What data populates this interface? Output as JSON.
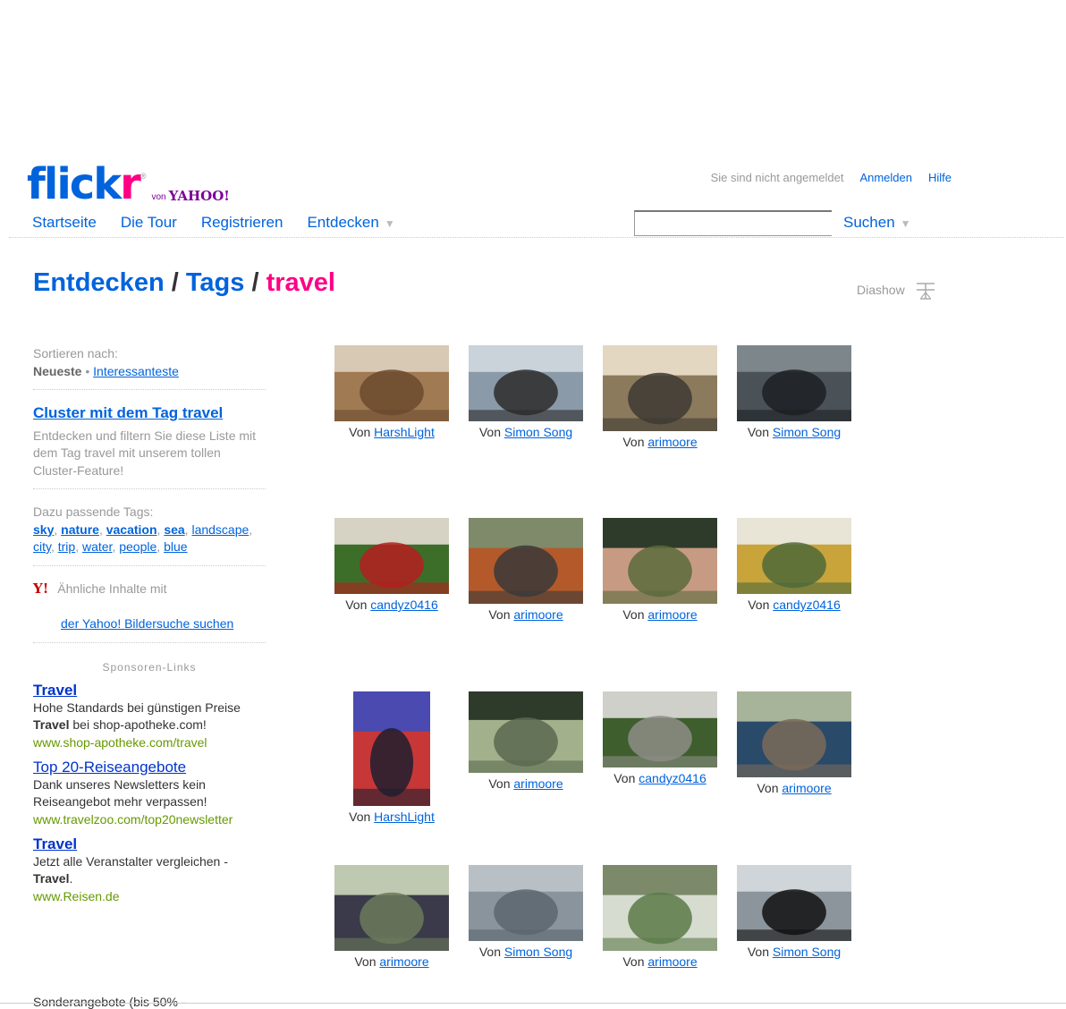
{
  "header": {
    "logo_text": "flickr",
    "logo_von": "von",
    "logo_yahoo": "YAHOO!",
    "status": "Sie sind nicht angemeldet",
    "login": "Anmelden",
    "help": "Hilfe",
    "nav": [
      "Startseite",
      "Die Tour",
      "Registrieren",
      "Entdecken"
    ],
    "search_value": "",
    "search_button": "Suchen"
  },
  "title": {
    "part1": "Entdecken",
    "sep1": "/",
    "part2": "Tags",
    "sep2": "/",
    "tag": "travel"
  },
  "slideshow": "Diashow",
  "sidebar": {
    "sort_label": "Sortieren nach:",
    "sort_current": "Neueste",
    "sort_alt": "Interessanteste",
    "cluster_link": "Cluster mit dem Tag travel",
    "cluster_desc": "Entdecken und filtern Sie diese Liste mit dem Tag travel mit unserem tollen Cluster-Feature!",
    "related_label": "Dazu passende Tags:",
    "related_tags": [
      "sky",
      "nature",
      "vacation",
      "sea",
      "landscape",
      "city",
      "trip",
      "water",
      "people",
      "blue"
    ],
    "yahoo_text": "Ähnliche Inhalte mit",
    "yahoo_link": "der Yahoo! Bildersuche suchen",
    "sponsor_label": "Sponsoren-Links",
    "ads": [
      {
        "title": "Travel",
        "line1": "Hohe Standards bei günstigen Preise ",
        "bold": "Travel",
        "line2": " bei shop-apotheke.com!",
        "url": "www.shop-apotheke.com/travel"
      },
      {
        "title": "Top 20-Reiseangebote",
        "line1": "Dank unseres Newsletters kein Reiseangebot mehr verpassen!",
        "bold": "",
        "line2": "",
        "url": "www.travelzoo.com/top20newsletter"
      },
      {
        "title": "Travel",
        "line1": "Jetzt alle Veranstalter vergleichen - ",
        "bold": "Travel",
        "line2": ".",
        "url": "www.Reisen.de"
      }
    ],
    "cutoff": "Sonderangebote (bis 50% -"
  },
  "photos": [
    {
      "by": "Von",
      "user": "HarshLight",
      "tone": "wood"
    },
    {
      "by": "Von",
      "user": "Simon Song",
      "tone": "balcony"
    },
    {
      "by": "Von",
      "user": "arimoore",
      "tone": "bread"
    },
    {
      "by": "Von",
      "user": "Simon Song",
      "tone": "dusk"
    },
    {
      "by": "Von",
      "user": "candyz0416",
      "tone": "flowers"
    },
    {
      "by": "Von",
      "user": "arimoore",
      "tone": "hug"
    },
    {
      "by": "Von",
      "user": "arimoore",
      "tone": "women"
    },
    {
      "by": "Von",
      "user": "candyz0416",
      "tone": "sign"
    },
    {
      "by": "Von",
      "user": "HarshLight",
      "tone": "figures"
    },
    {
      "by": "Von",
      "user": "arimoore",
      "tone": "garden"
    },
    {
      "by": "Von",
      "user": "candyz0416",
      "tone": "path"
    },
    {
      "by": "Von",
      "user": "arimoore",
      "tone": "couple"
    },
    {
      "by": "Von",
      "user": "arimoore",
      "tone": "party"
    },
    {
      "by": "Von",
      "user": "Simon Song",
      "tone": "lake"
    },
    {
      "by": "Von",
      "user": "arimoore",
      "tone": "fountain"
    },
    {
      "by": "Von",
      "user": "Simon Song",
      "tone": "window"
    }
  ],
  "colors": {
    "brand_blue": "#0063dc",
    "brand_pink": "#ff0084",
    "ad_url_green": "#669900"
  }
}
